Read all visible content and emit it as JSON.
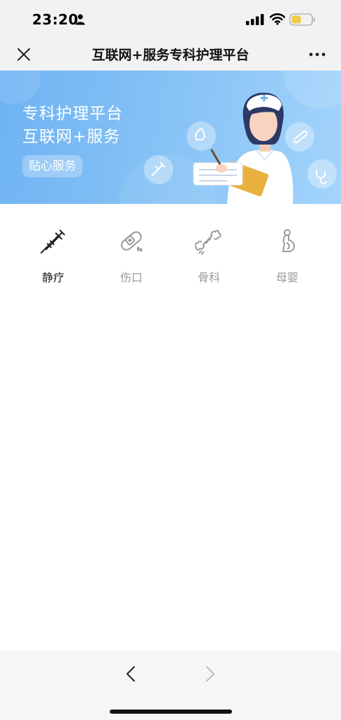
{
  "status_bar": {
    "time": "23:20",
    "icons": [
      "person-icon",
      "signal-icon",
      "wifi-icon",
      "battery-icon"
    ],
    "battery_color": "#f2c94c"
  },
  "nav": {
    "title": "互联网+服务专科护理平台",
    "close_icon": "close-icon",
    "more_icon": "more-icon"
  },
  "banner": {
    "line1": "专科护理平台",
    "line2": "互联网+服务",
    "badge": "贴心服务",
    "gradient_start": "#6fb3f3",
    "gradient_end": "#a3d4fb"
  },
  "categories": [
    {
      "label": "静疗",
      "icon": "syringe-icon",
      "active": true
    },
    {
      "label": "伤口",
      "icon": "bandage-icon",
      "active": false
    },
    {
      "label": "骨科",
      "icon": "bone-icon",
      "active": false
    },
    {
      "label": "母婴",
      "icon": "pregnant-icon",
      "active": false
    }
  ],
  "bottom_bar": {
    "back_icon": "chevron-left-icon",
    "forward_icon": "chevron-right-icon"
  }
}
